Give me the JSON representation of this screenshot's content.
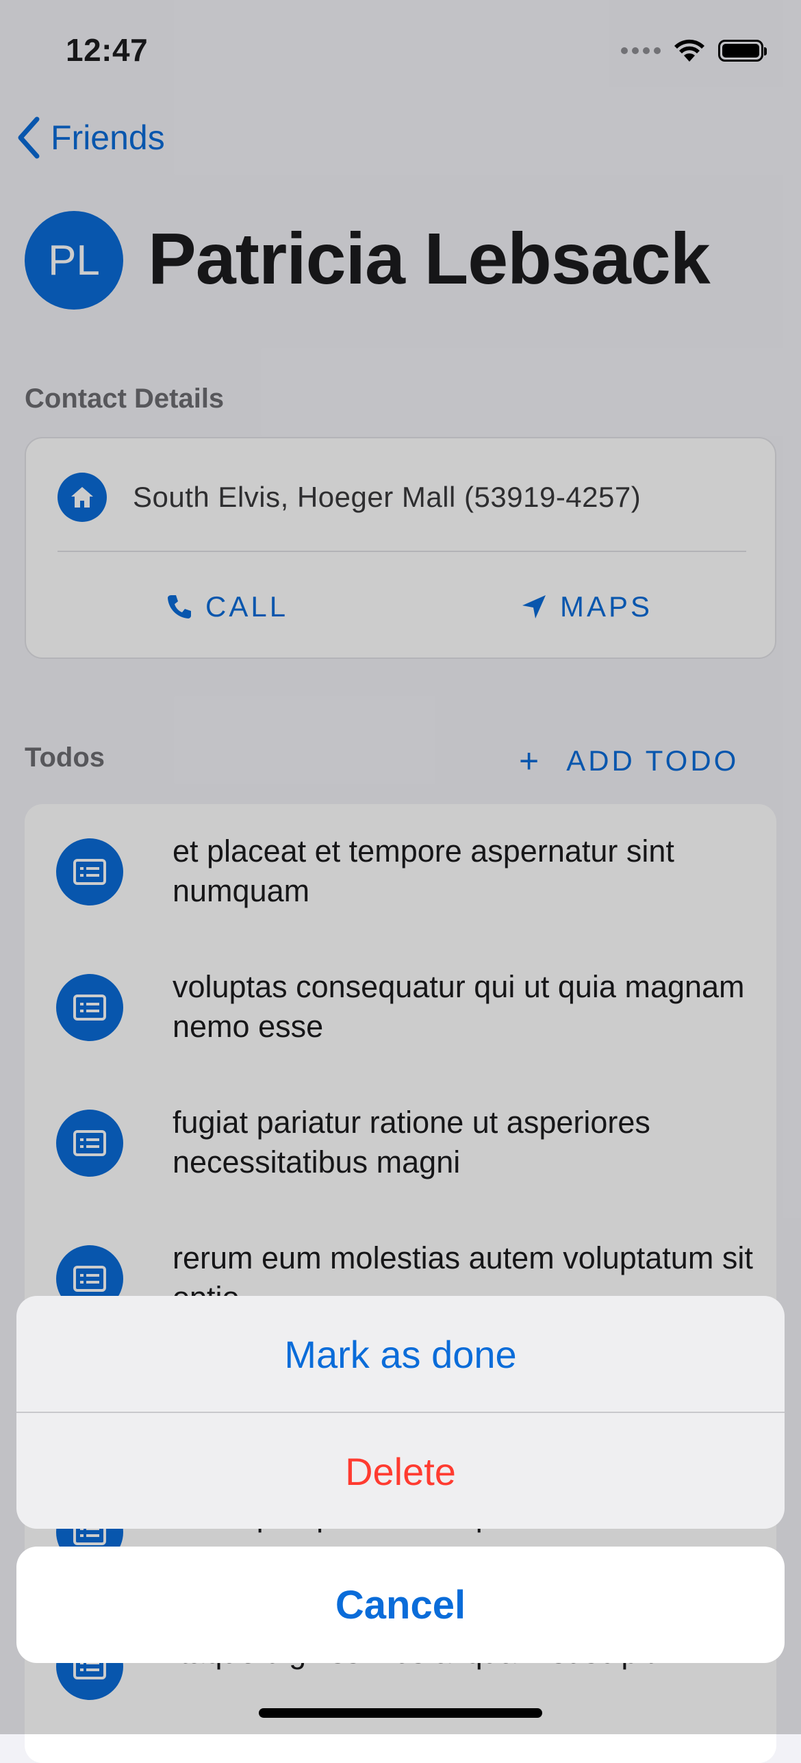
{
  "status_bar": {
    "time": "12:47"
  },
  "nav": {
    "back_label": "Friends"
  },
  "profile": {
    "initials": "PL",
    "name": "Patricia Lebsack"
  },
  "contact": {
    "header": "Contact Details",
    "address": "South Elvis, Hoeger Mall (53919-4257)",
    "call_label": "CALL",
    "maps_label": "MAPS"
  },
  "todos": {
    "header": "Todos",
    "add_label": "ADD TODO",
    "items": [
      "et placeat et tempore aspernatur sint numquam",
      "voluptas consequatur qui ut quia magnam nemo esse",
      "fugiat pariatur ratione ut asperiores necessitatibus magni",
      "rerum eum molestias autem voluptatum sit optio",
      "aut id perspiciatis voluptatem iusto",
      "itaque dignissimos aliquam suscipit"
    ]
  },
  "action_sheet": {
    "mark_done": "Mark as done",
    "delete": "Delete",
    "cancel": "Cancel"
  },
  "colors": {
    "accent": "#0a6cd9",
    "destructive": "#ff3b30"
  }
}
